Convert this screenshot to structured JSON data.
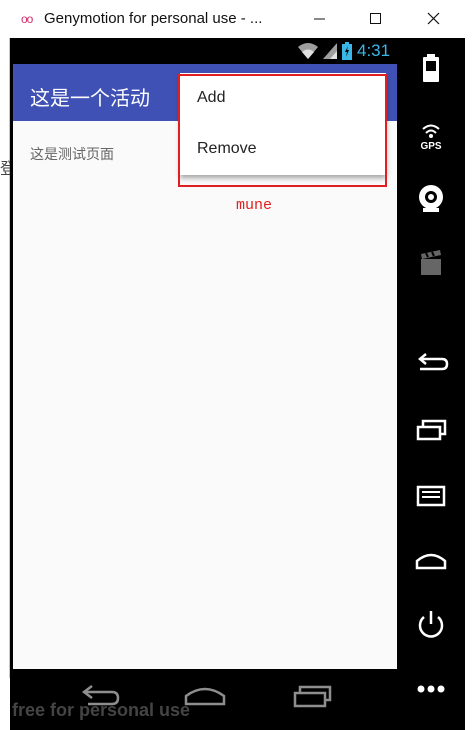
{
  "window": {
    "title": "Genymotion for personal use - ...",
    "app_icon": "oo",
    "buttons": [
      "minimize-icon",
      "maximize-icon",
      "close-icon"
    ]
  },
  "left_fragment": "登",
  "status_bar": {
    "time": "4:31",
    "icons": [
      "wifi-icon",
      "signal-icon",
      "battery-icon"
    ],
    "accent_color": "#3ab6e8"
  },
  "app_bar": {
    "title": "这是一个活动",
    "color": "#3f51b5"
  },
  "content": {
    "text": "这是测试页面"
  },
  "overflow_menu": {
    "items": [
      {
        "label": "Add"
      },
      {
        "label": "Remove"
      }
    ]
  },
  "annotation": {
    "label": "mune",
    "color": "#e02020"
  },
  "nav_bar": {
    "icons": [
      "back-icon",
      "home-icon",
      "recents-icon"
    ]
  },
  "side_panel": {
    "icons": [
      "battery-widget-icon",
      "gps-icon",
      "camera-icon",
      "media-icon",
      "back-icon",
      "recents-icon",
      "menu-icon",
      "home-icon",
      "power-icon",
      "more-icon"
    ],
    "gps_label": "GPS"
  },
  "watermark": "free for personal use"
}
